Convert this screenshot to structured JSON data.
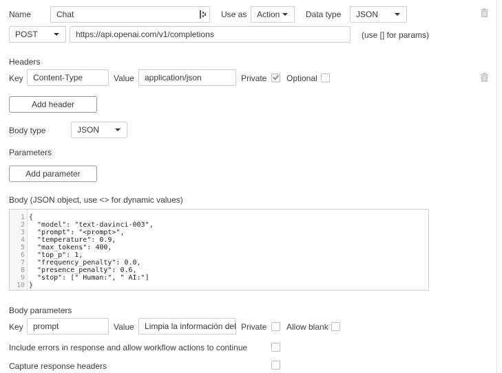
{
  "call": {
    "name_label": "Name",
    "name_value": "Chat",
    "use_as_label": "Use as",
    "use_as_value": "Action",
    "data_type_label": "Data type",
    "data_type_value": "JSON",
    "method_value": "POST",
    "url_value": "https://api.openai.com/v1/completions",
    "url_hint": "(use [] for params)"
  },
  "headers": {
    "section_label": "Headers",
    "key_label": "Key",
    "key_value": "Content-Type",
    "value_label": "Value",
    "value_value": "application/json",
    "private_label": "Private",
    "private_checked": true,
    "optional_label": "Optional",
    "optional_checked": false,
    "add_button": "Add header"
  },
  "body_type": {
    "label": "Body type",
    "value": "JSON"
  },
  "parameters": {
    "section_label": "Parameters",
    "add_button": "Add parameter"
  },
  "body": {
    "label": "Body (JSON object, use <> for dynamic values)",
    "line_numbers": [
      "1",
      "2",
      "3",
      "4",
      "5",
      "6",
      "7",
      "8",
      "9",
      "10"
    ],
    "lines": [
      "{",
      "  \"model\": \"text-davinci-003\",",
      "  \"prompt\": \"<prompt>\",",
      "  \"temperature\": 0.9,",
      "  \"max_tokens\": 400,",
      "  \"top_p\": 1,",
      "  \"frequency_penalty\": 0.0,",
      "  \"presence_penalty\": 0.6,",
      "  \"stop\": [\" Human:\", \" AI:\"]",
      "}"
    ]
  },
  "body_parameters": {
    "section_label": "Body parameters",
    "key_label": "Key",
    "key_value": "prompt",
    "value_label": "Value",
    "value_value": "Limpia la información del",
    "private_label": "Private",
    "private_checked": false,
    "allow_blank_label": "Allow blank",
    "allow_blank_checked": false
  },
  "options": {
    "include_errors_label": "Include errors in response and allow workflow actions to continue",
    "include_errors_checked": false,
    "capture_headers_label": "Capture response headers",
    "capture_headers_checked": false
  },
  "icons": {
    "trash": "trash-icon",
    "dynamic_insert": "dynamic-insert-icon",
    "caret": "chevron-down-icon",
    "check": "check-icon"
  }
}
